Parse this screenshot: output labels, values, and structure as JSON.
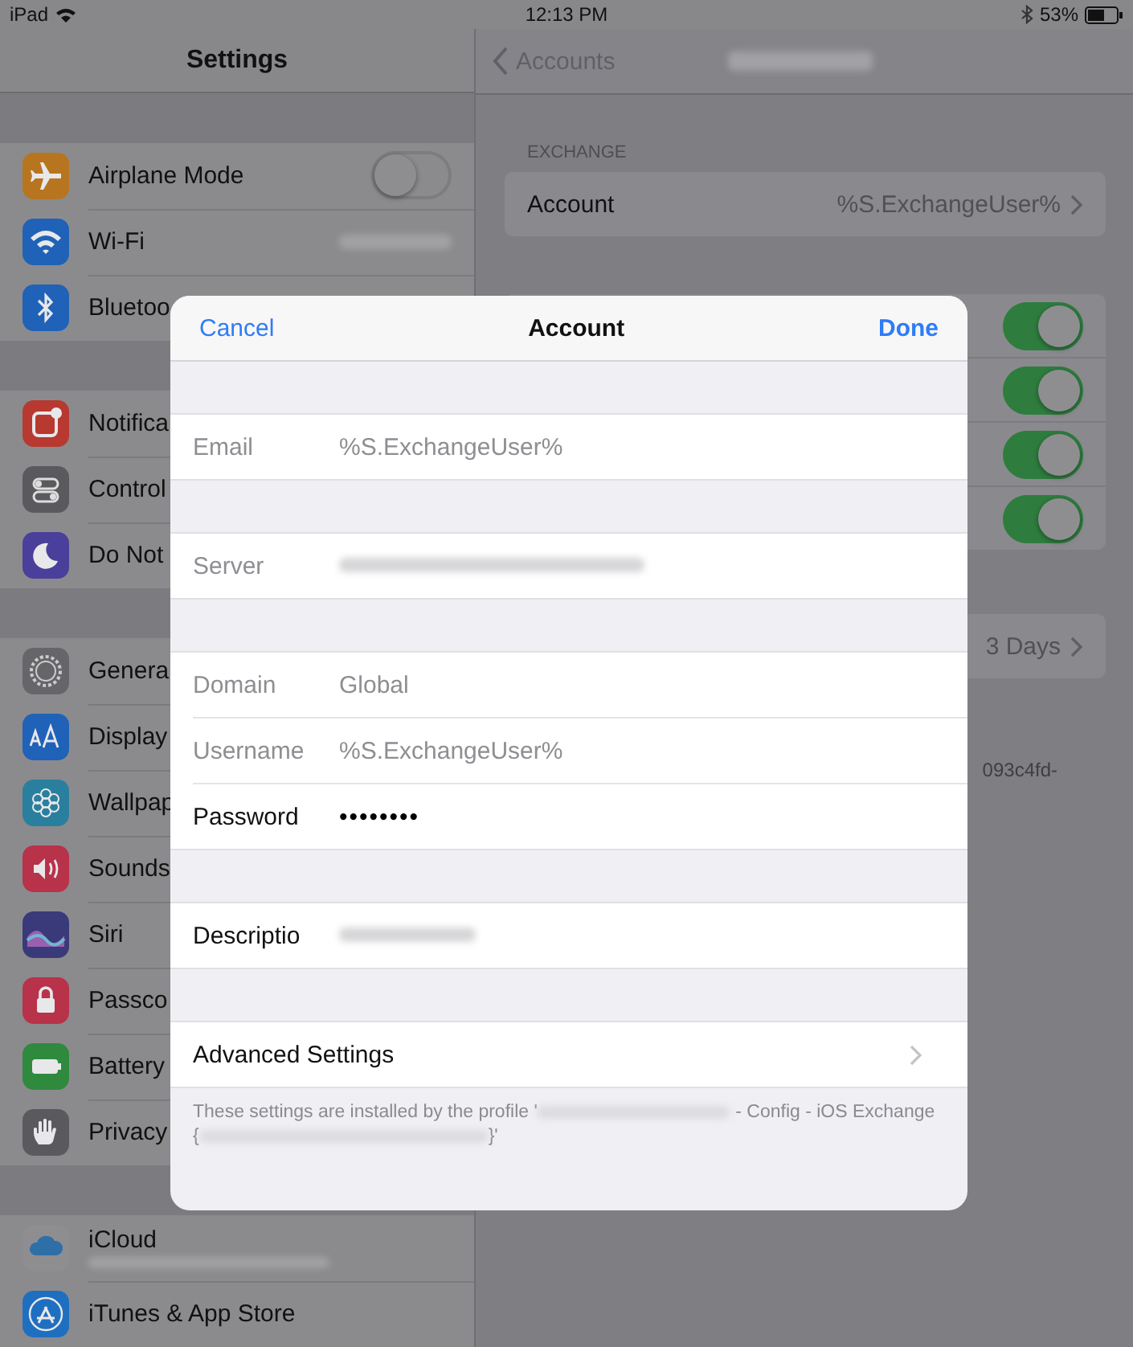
{
  "status_bar": {
    "device": "iPad",
    "time": "12:13 PM",
    "battery": "53%"
  },
  "sidebar": {
    "title": "Settings",
    "groups": [
      [
        {
          "kind": "toggle",
          "label": "Airplane Mode",
          "color": "#b8751f",
          "on": false
        },
        {
          "kind": "value",
          "label": "Wi-Fi",
          "color": "#1f62b8"
        },
        {
          "kind": "plain",
          "label": "Bluetoo",
          "color": "#1f62b8"
        }
      ],
      [
        {
          "kind": "plain",
          "label": "Notifica",
          "color": "#b8392f"
        },
        {
          "kind": "plain",
          "label": "Control",
          "color": "#5a5a5e"
        },
        {
          "kind": "plain",
          "label": "Do Not",
          "color": "#4a3f9a"
        }
      ],
      [
        {
          "kind": "plain",
          "label": "Genera",
          "color": "#66666a"
        },
        {
          "kind": "plain",
          "label": "Display",
          "color": "#1f62b8"
        },
        {
          "kind": "plain",
          "label": "Wallpap",
          "color": "#2a7f9e"
        },
        {
          "kind": "plain",
          "label": "Sounds",
          "color": "#b8324a"
        },
        {
          "kind": "plain",
          "label": "Siri",
          "color": "#3a3a7a"
        },
        {
          "kind": "plain",
          "label": "Passco",
          "color": "#b8324a"
        },
        {
          "kind": "plain",
          "label": "Battery",
          "color": "#2f8a3e"
        },
        {
          "kind": "plain",
          "label": "Privacy",
          "color": "#5a5a5e"
        }
      ],
      [
        {
          "kind": "account",
          "label": "iCloud",
          "color": "#8e8e91"
        },
        {
          "kind": "plain",
          "label": "iTunes & App Store",
          "color": "#1f6fc0"
        }
      ]
    ]
  },
  "detail": {
    "back": "Accounts",
    "section_header": "EXCHANGE",
    "account_row": {
      "label": "Account",
      "value": "%S.ExchangeUser%"
    },
    "toggles": [
      {
        "on": true
      },
      {
        "on": true
      },
      {
        "on": true
      },
      {
        "on": true
      }
    ],
    "sync_value": "3 Days",
    "footnote": "093c4fd-"
  },
  "sheet": {
    "cancel": "Cancel",
    "title": "Account",
    "done": "Done",
    "sections": [
      [
        {
          "kind": "field",
          "label": "Email",
          "value": "%S.ExchangeUser%",
          "disabled": true
        }
      ],
      [
        {
          "kind": "field",
          "label": "Server",
          "disabled": true,
          "value_redacted": true
        }
      ],
      [
        {
          "kind": "field",
          "label": "Domain",
          "value": "Global",
          "disabled": true
        },
        {
          "kind": "field",
          "label": "Username",
          "value": "%S.ExchangeUser%",
          "disabled": true
        },
        {
          "kind": "secure",
          "label": "Password",
          "value": "••••••••",
          "disabled": false
        }
      ],
      [
        {
          "kind": "field",
          "label": "Descriptio",
          "disabled": false,
          "value_redacted": true
        }
      ],
      [
        {
          "kind": "link",
          "label": "Advanced Settings"
        }
      ]
    ],
    "footer": [
      {
        "kind": "text",
        "text": "These settings are installed by the profile '"
      },
      {
        "kind": "redacted"
      },
      {
        "kind": "text",
        "text": " - Config - iOS Exchange {"
      },
      {
        "kind": "redacted"
      },
      {
        "kind": "text",
        "text": "}'"
      }
    ]
  }
}
